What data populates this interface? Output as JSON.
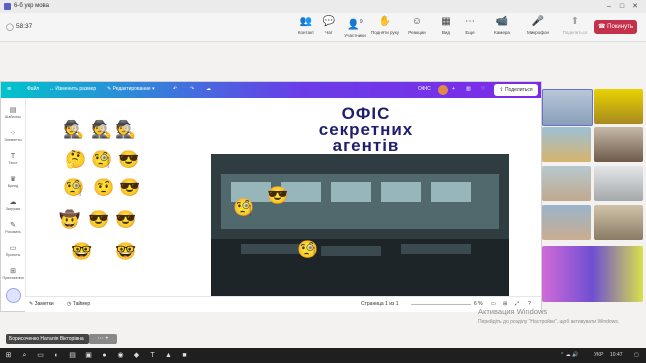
{
  "window": {
    "title": "6-б укр мова"
  },
  "meeting": {
    "timer": "58:37",
    "controls": [
      {
        "label": "Контакт",
        "icon": "people-icon",
        "glyph": "👥"
      },
      {
        "label": "Чат",
        "icon": "chat-icon",
        "glyph": "💬"
      },
      {
        "label": "Участники",
        "icon": "participants-icon",
        "glyph": "👤",
        "badge": "9"
      },
      {
        "label": "Подняти руку",
        "icon": "raise-hand-icon",
        "glyph": "✋"
      },
      {
        "label": "Реакции",
        "icon": "reactions-icon",
        "glyph": "☺"
      },
      {
        "label": "Вид",
        "icon": "view-icon",
        "glyph": "▦"
      },
      {
        "label": "Еще",
        "icon": "more-icon",
        "glyph": "⋯"
      },
      {
        "label": "Камера",
        "icon": "camera-icon",
        "glyph": "📹"
      },
      {
        "label": "Микрофон",
        "icon": "microphone-icon",
        "glyph": "🎤"
      },
      {
        "label": "Поделиться",
        "icon": "share-screen-icon",
        "glyph": "⬆"
      }
    ],
    "leave_label": "Покинуть"
  },
  "canva": {
    "menu": [
      "Файл",
      "Изменить размер",
      "Редактирование"
    ],
    "doc_title": "ОФІС",
    "share_label": "Поделиться",
    "sidebar": [
      "Шаблоны",
      "Элементы",
      "Текст",
      "Бренд",
      "Загрузки",
      "Рисовать",
      "Проекты",
      "Приложения"
    ],
    "slide": {
      "title_line1": "ОФІС",
      "title_line2": "секретних",
      "title_line3": "агентів"
    },
    "bottom": {
      "notes": "Заметки",
      "timer": "Таймер",
      "page": "Страница 1 из 1",
      "zoom": "6 %"
    }
  },
  "presenter_name": "Борисоченко Наталія Вікторівна",
  "activation": {
    "title": "Активация Windows",
    "text": "Перейдіть до розділу \"Настройки\", щоб активувати Windows."
  },
  "taskbar": {
    "lang": "УКР",
    "time": "10:47"
  }
}
